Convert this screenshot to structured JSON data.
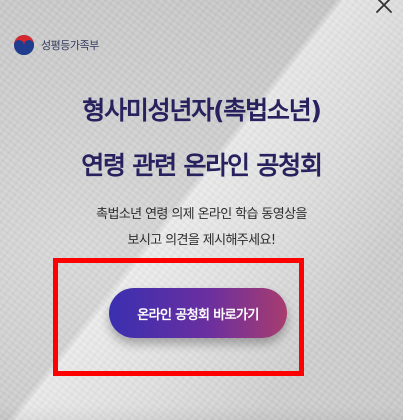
{
  "logo": {
    "text": "성평등가족부",
    "icon": "taegeuk-emblem-icon"
  },
  "headline": {
    "line1": "형사미성년자(촉법소년)",
    "line2": "연령 관련 온라인 공청회"
  },
  "description": {
    "line1": "촉법소년 연령 의제 온라인 학습 동영상을",
    "line2": "보시고 의견을 제시해주세요!"
  },
  "cta": {
    "label": "온라인 공청회 바로가기"
  },
  "close": {
    "icon": "close-icon"
  },
  "colors": {
    "headline": "#27215e",
    "cta_start": "#3a2fb0",
    "cta_end": "#a83c6f",
    "highlight": "#ff0000"
  }
}
